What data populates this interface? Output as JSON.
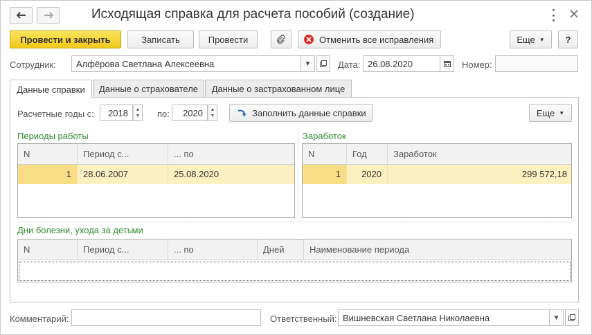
{
  "window": {
    "title": "Исходящая справка для расчета пособий (создание)"
  },
  "toolbar": {
    "post_close": "Провести и закрыть",
    "save": "Записать",
    "post": "Провести",
    "cancel_corrections": "Отменить все исправления",
    "more": "Еще",
    "help": "?"
  },
  "employee": {
    "label": "Сотрудник:",
    "value": "Алфёрова Светлана Алексеевна"
  },
  "date": {
    "label": "Дата:",
    "value": "26.08.2020"
  },
  "number": {
    "label": "Номер:",
    "value": ""
  },
  "tabs": [
    {
      "label": "Данные справки"
    },
    {
      "label": "Данные о страхователе"
    },
    {
      "label": "Данные о застрахованном лице"
    }
  ],
  "years": {
    "label_from": "Расчетные годы с:",
    "from": "2018",
    "label_to": "по:",
    "to": "2020"
  },
  "fill_button": "Заполнить данные справки",
  "panel_more": "Еще",
  "work_periods": {
    "title": "Периоды работы",
    "columns": [
      "N",
      "Период с...",
      "... по"
    ],
    "rows": [
      {
        "n": "1",
        "from": "28.06.2007",
        "to": "25.08.2020"
      }
    ]
  },
  "earnings": {
    "title": "Заработок",
    "columns": [
      "N",
      "Год",
      "Заработок"
    ],
    "rows": [
      {
        "n": "1",
        "year": "2020",
        "amount": "299 572,18"
      }
    ]
  },
  "sick_days": {
    "title": "Дни болезни, ухода за детьми",
    "columns": [
      "N",
      "Период с...",
      "... по",
      "Дней",
      "Наименование периода"
    ]
  },
  "comment": {
    "label": "Комментарий:",
    "value": ""
  },
  "responsible": {
    "label": "Ответственный:",
    "value": "Вишневская Светлана Николаевна"
  },
  "colors": {
    "accent_yellow": "#f1c91b",
    "section_green": "#2c8a2c",
    "row_highlight": "#fbf0c0",
    "cancel_red": "#d9312c"
  }
}
